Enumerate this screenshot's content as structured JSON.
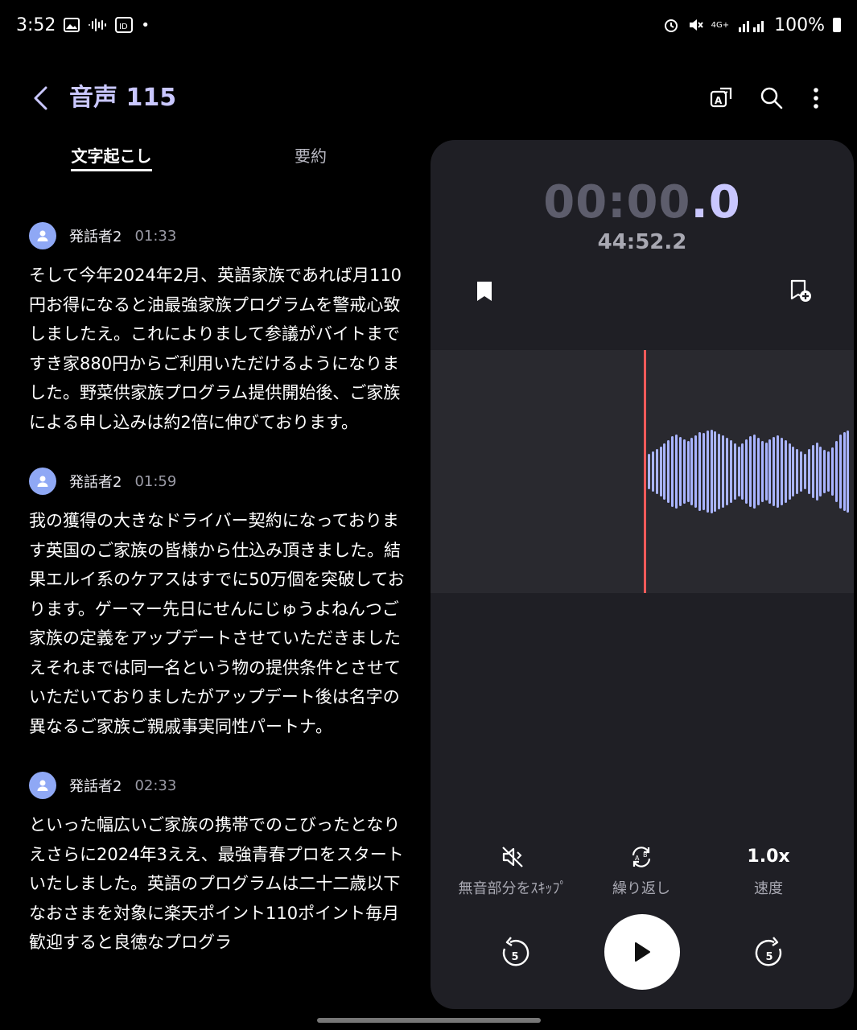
{
  "status_bar": {
    "time": "3:52",
    "battery": "100%",
    "network": "4G+"
  },
  "header": {
    "title": "音声 115"
  },
  "tabs": [
    {
      "label": "文字起こし",
      "active": true
    },
    {
      "label": "要約",
      "active": false
    }
  ],
  "transcript": [
    {
      "speaker": "発話者2",
      "time": "01:33",
      "text": "そして今年2024年2月、英語家族であれば月110円お得になると油最強家族プログラムを警戒心致しましたえ。これによりまして参議がバイトまですき家880円からご利用いただけるようになりました。野菜供家族プログラム提供開始後、ご家族による申し込みは約2倍に伸びております。"
    },
    {
      "speaker": "発話者2",
      "time": "01:59",
      "text": "我の獲得の大きなドライバー契約になっております英国のご家族の皆様から仕込み頂きました。結果エルイ系のケアスはすでに50万個を突破しております。ゲーマー先日にせんにじゅうよねんつご家族の定義をアップデートさせていただきましたえそれまでは同一名という物の提供条件とさせていただいておりましたがアップデート後は名字の異なるご家族ご親戚事実同性パートナ。"
    },
    {
      "speaker": "発話者2",
      "time": "02:33",
      "text": "といった幅広いご家族の携帯でのこびったとなりえさらに2024年3ええ、最強青春プロをスタートいたしました。英語のプログラムは二十二歳以下なおさまを対象に楽天ポイント110ポイント毎月歓迎すると良徳なプログラ"
    }
  ],
  "player": {
    "timer_dim": "00:00",
    "timer_bright": ".0",
    "total": "44:52.2",
    "skip_silence_label": "無音部分をｽｷｯﾌﾟ",
    "repeat_label": "繰り返し",
    "speed_value": "1.0x",
    "speed_label": "速度",
    "rewind_seconds": "5",
    "forward_seconds": "5"
  },
  "colors": {
    "accent": "#c9c7ff",
    "panel": "#1f1f25",
    "waveform_bg": "#29292f",
    "waveform_bar": "#a9b4ff",
    "playhead": "#ff5a5a",
    "avatar": "#8fa8f5"
  }
}
